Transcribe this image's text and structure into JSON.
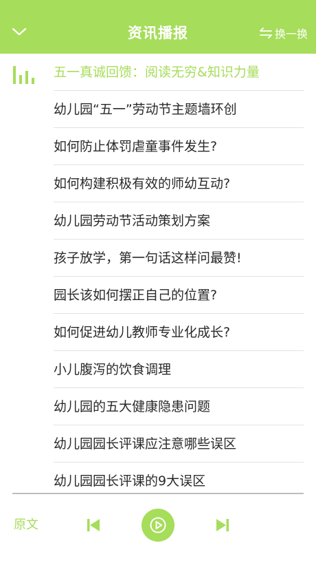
{
  "header": {
    "title": "资讯播报",
    "refresh_label": "换一换"
  },
  "colors": {
    "accent": "#a6dd5a",
    "text": "#2a2a2a",
    "divider": "#e2e2e2"
  },
  "list": {
    "items": [
      {
        "title": "五一真诚回馈：阅读无穷&知识力量",
        "active": true
      },
      {
        "title": "幼儿园“五一”劳动节主题墙环创"
      },
      {
        "title": "如何防止体罚虐童事件发生?"
      },
      {
        "title": "如何构建积极有效的师幼互动?"
      },
      {
        "title": "幼儿园劳动节活动策划方案"
      },
      {
        "title": "孩子放学，第一句话这样问最赞!"
      },
      {
        "title": "园长该如何摆正自己的位置?"
      },
      {
        "title": "如何促进幼儿教师专业化成长?"
      },
      {
        "title": "小儿腹泻的饮食调理"
      },
      {
        "title": "幼儿园的五大健康隐患问题"
      },
      {
        "title": "幼儿园园长评课应注意哪些误区"
      },
      {
        "title": "幼儿园园长评课的9大误区"
      }
    ]
  },
  "player": {
    "original_label": "原文",
    "icons": [
      "skip-previous-icon",
      "play-icon",
      "skip-next-icon"
    ]
  }
}
